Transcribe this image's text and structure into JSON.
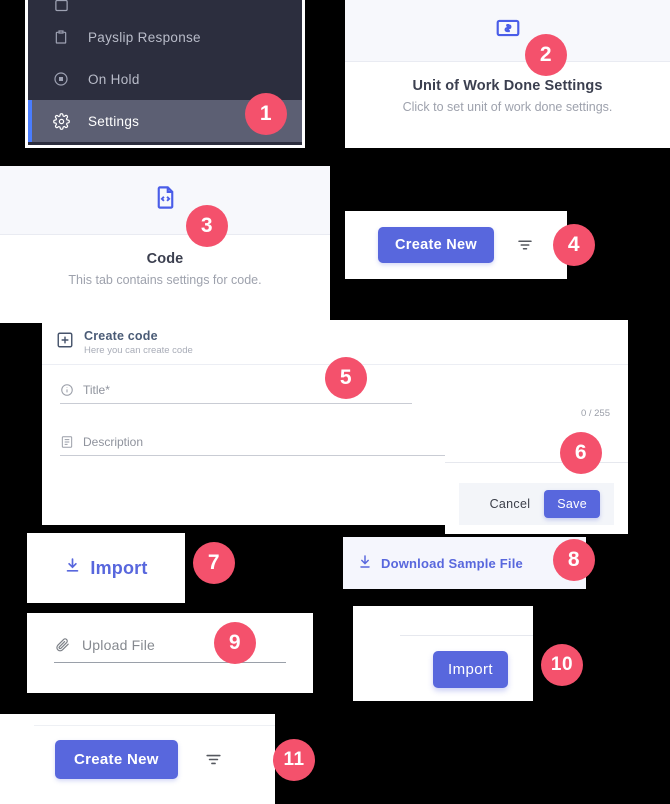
{
  "sidebar": {
    "items": [
      {
        "label": "",
        "icon": "list-icon",
        "state": "partial"
      },
      {
        "label": "Payslip Response",
        "icon": "clipboard-icon",
        "state": "normal"
      },
      {
        "label": "On Hold",
        "icon": "pause-circle-icon",
        "state": "normal"
      },
      {
        "label": "Settings",
        "icon": "gear-icon",
        "state": "active"
      }
    ]
  },
  "unit_card": {
    "icon": "money-bill-icon",
    "title": "Unit of Work Done Settings",
    "subtitle": "Click to set unit of work done settings."
  },
  "code_card": {
    "icon": "code-file-icon",
    "title": "Code",
    "subtitle": "This tab contains settings for code."
  },
  "toolbar": {
    "create_new_label": "Create New",
    "filter_icon": "filter-icon"
  },
  "form": {
    "header_icon": "plus-box-icon",
    "header_title": "Create code",
    "header_subtitle": "Here you can create code",
    "title_field": {
      "icon": "info-circle-icon",
      "placeholder": "Title*",
      "value": "",
      "counter": "0 / 255"
    },
    "description_field": {
      "icon": "description-icon",
      "placeholder": "Description",
      "value": ""
    }
  },
  "footer": {
    "cancel_label": "Cancel",
    "save_label": "Save"
  },
  "import_link": {
    "icon": "download-icon",
    "label": "Import"
  },
  "sample_file": {
    "icon": "download-arrow-icon",
    "label": "Download Sample File"
  },
  "upload": {
    "icon": "paperclip-icon",
    "label": "Upload File",
    "value": ""
  },
  "import_action": {
    "label": "Import"
  },
  "badges": {
    "b1": "1",
    "b2": "2",
    "b3": "3",
    "b4": "4",
    "b5": "5",
    "b6": "6",
    "b7": "7",
    "b8": "8",
    "b9": "9",
    "b10": "10",
    "b11": "11"
  },
  "colors": {
    "badge": "#f4516c",
    "primary": "#5867dd",
    "sidebar_bg": "#2c2e3e",
    "sidebar_active": "#5c5f73",
    "sidebar_accent": "#4a7dff",
    "tile_head_bg": "#f7f8fc"
  }
}
